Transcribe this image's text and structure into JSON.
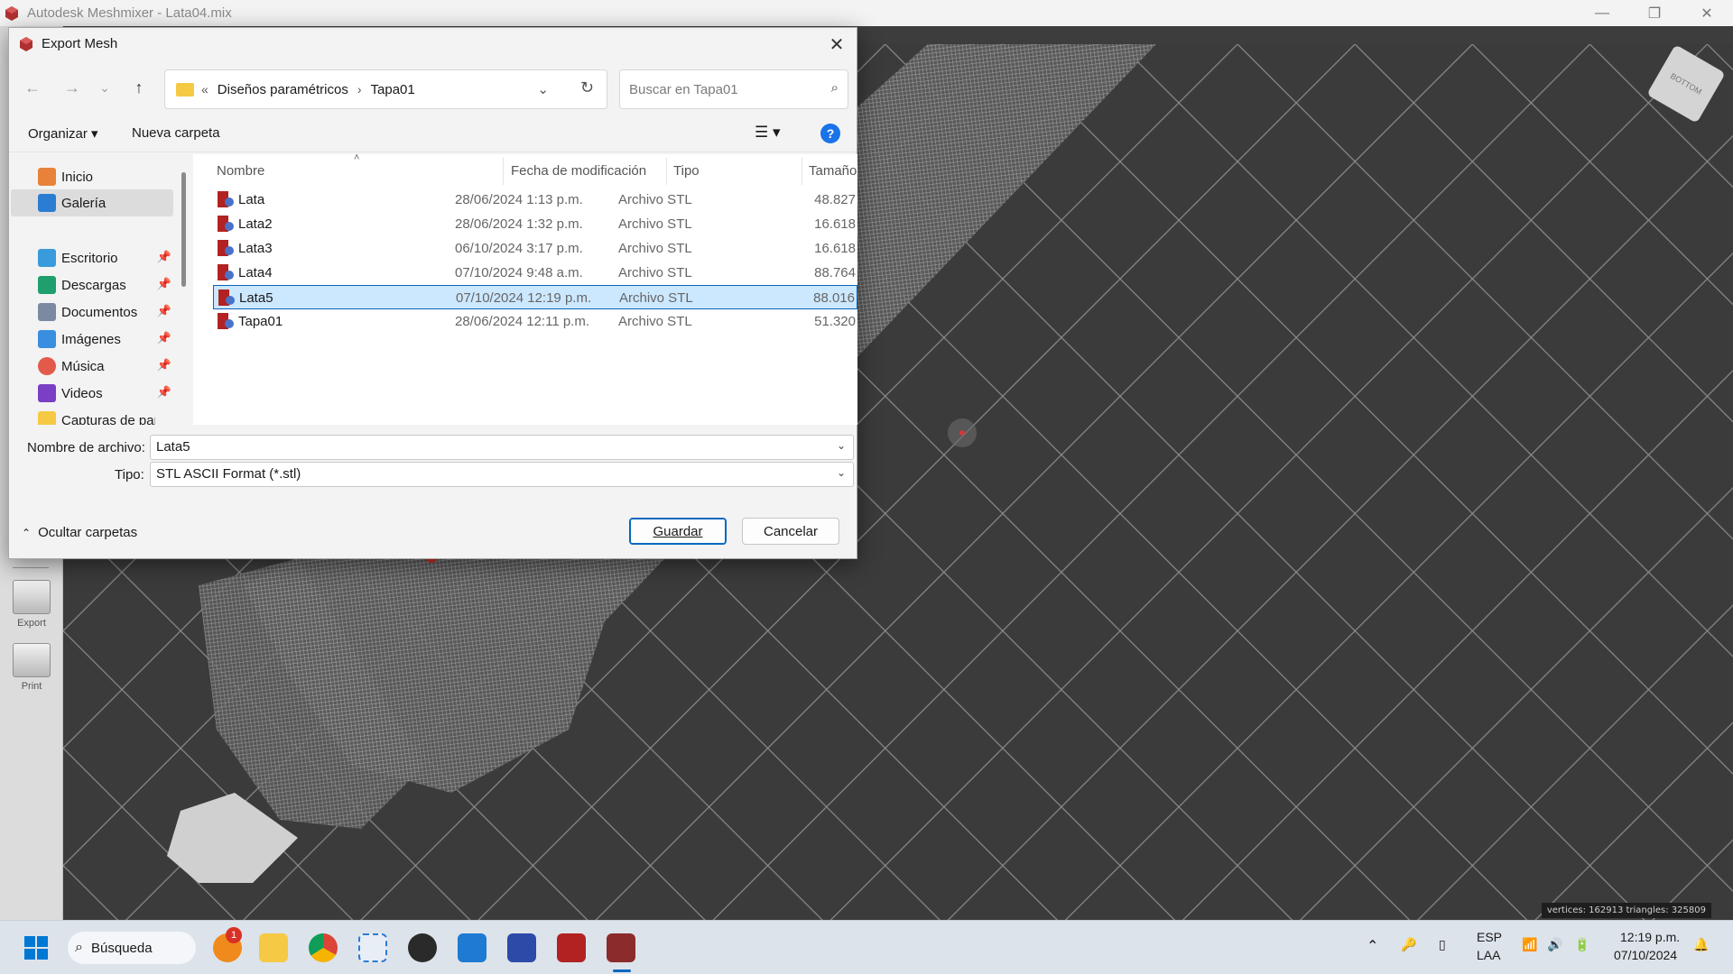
{
  "app": {
    "title": "Autodesk Meshmixer - Lata04.mix",
    "minimize": "—",
    "restore": "❐",
    "close": "✕"
  },
  "left_toolbar": {
    "items": [
      {
        "label": "Export",
        "icon": "export-icon"
      },
      {
        "label": "Print",
        "icon": "print-icon"
      }
    ]
  },
  "viewport": {
    "stats": "vertices: 162913 triangles: 325809",
    "viewcube_label": "BOTTOM"
  },
  "dialog": {
    "title": "Export Mesh",
    "nav": {
      "back": "←",
      "forward": "→",
      "recent": "⌄",
      "up": "↑"
    },
    "address": {
      "overflow": "«",
      "crumbs": [
        "Diseños paramétricos",
        "Tapa01"
      ],
      "sep": "›"
    },
    "search": {
      "placeholder": "Buscar en Tapa01"
    },
    "commands": {
      "organize": "Organizar",
      "new_folder": "Nueva carpeta"
    },
    "nav_pane": {
      "items": [
        {
          "label": "Inicio",
          "icon": "home-icon",
          "color": "#e8823a",
          "pinned": false,
          "selected": false
        },
        {
          "label": "Galería",
          "icon": "gallery-icon",
          "color": "#2b7cd3",
          "pinned": false,
          "selected": true
        },
        {
          "label": "Escritorio",
          "icon": "desktop-icon",
          "color": "#3a9bdc",
          "pinned": true,
          "selected": false
        },
        {
          "label": "Descargas",
          "icon": "downloads-icon",
          "color": "#1f9e6e",
          "pinned": true,
          "selected": false
        },
        {
          "label": "Documentos",
          "icon": "documents-icon",
          "color": "#7b8aa0",
          "pinned": true,
          "selected": false
        },
        {
          "label": "Imágenes",
          "icon": "pictures-icon",
          "color": "#3a8ee0",
          "pinned": true,
          "selected": false
        },
        {
          "label": "Música",
          "icon": "music-icon",
          "color": "#e25a4a",
          "pinned": true,
          "selected": false
        },
        {
          "label": "Videos",
          "icon": "videos-icon",
          "color": "#7a3fc4",
          "pinned": true,
          "selected": false
        },
        {
          "label": "Capturas de pantalla",
          "icon": "folder-icon",
          "color": "#f6c944",
          "pinned": false,
          "selected": false
        }
      ],
      "pin_glyph": "📌"
    },
    "columns": {
      "name": "Nombre",
      "date": "Fecha de modificación",
      "type": "Tipo",
      "size": "Tamaño"
    },
    "files": [
      {
        "name": "Lata",
        "date": "28/06/2024 1:13 p.m.",
        "type": "Archivo STL",
        "size": "48.827",
        "selected": false
      },
      {
        "name": "Lata2",
        "date": "28/06/2024 1:32 p.m.",
        "type": "Archivo STL",
        "size": "16.618",
        "selected": false
      },
      {
        "name": "Lata3",
        "date": "06/10/2024 3:17 p.m.",
        "type": "Archivo STL",
        "size": "16.618",
        "selected": false
      },
      {
        "name": "Lata4",
        "date": "07/10/2024 9:48 a.m.",
        "type": "Archivo STL",
        "size": "88.764",
        "selected": false
      },
      {
        "name": "Lata5",
        "date": "07/10/2024 12:19 p.m.",
        "type": "Archivo STL",
        "size": "88.016",
        "selected": true
      },
      {
        "name": "Tapa01",
        "date": "28/06/2024 12:11 p.m.",
        "type": "Archivo STL",
        "size": "51.320",
        "selected": false
      }
    ],
    "form": {
      "filename_label": "Nombre de archivo:",
      "filename_value": "Lata5",
      "type_label": "Tipo:",
      "type_value": "STL ASCII Format (*.stl)"
    },
    "hide_folders": "Ocultar carpetas",
    "save": "Guardar",
    "cancel": "Cancelar"
  },
  "taskbar": {
    "search_label": "Búsqueda",
    "notification_count": "1",
    "language": "ESP",
    "layout": "LAA",
    "time": "12:19 p.m.",
    "date": "07/10/2024"
  }
}
